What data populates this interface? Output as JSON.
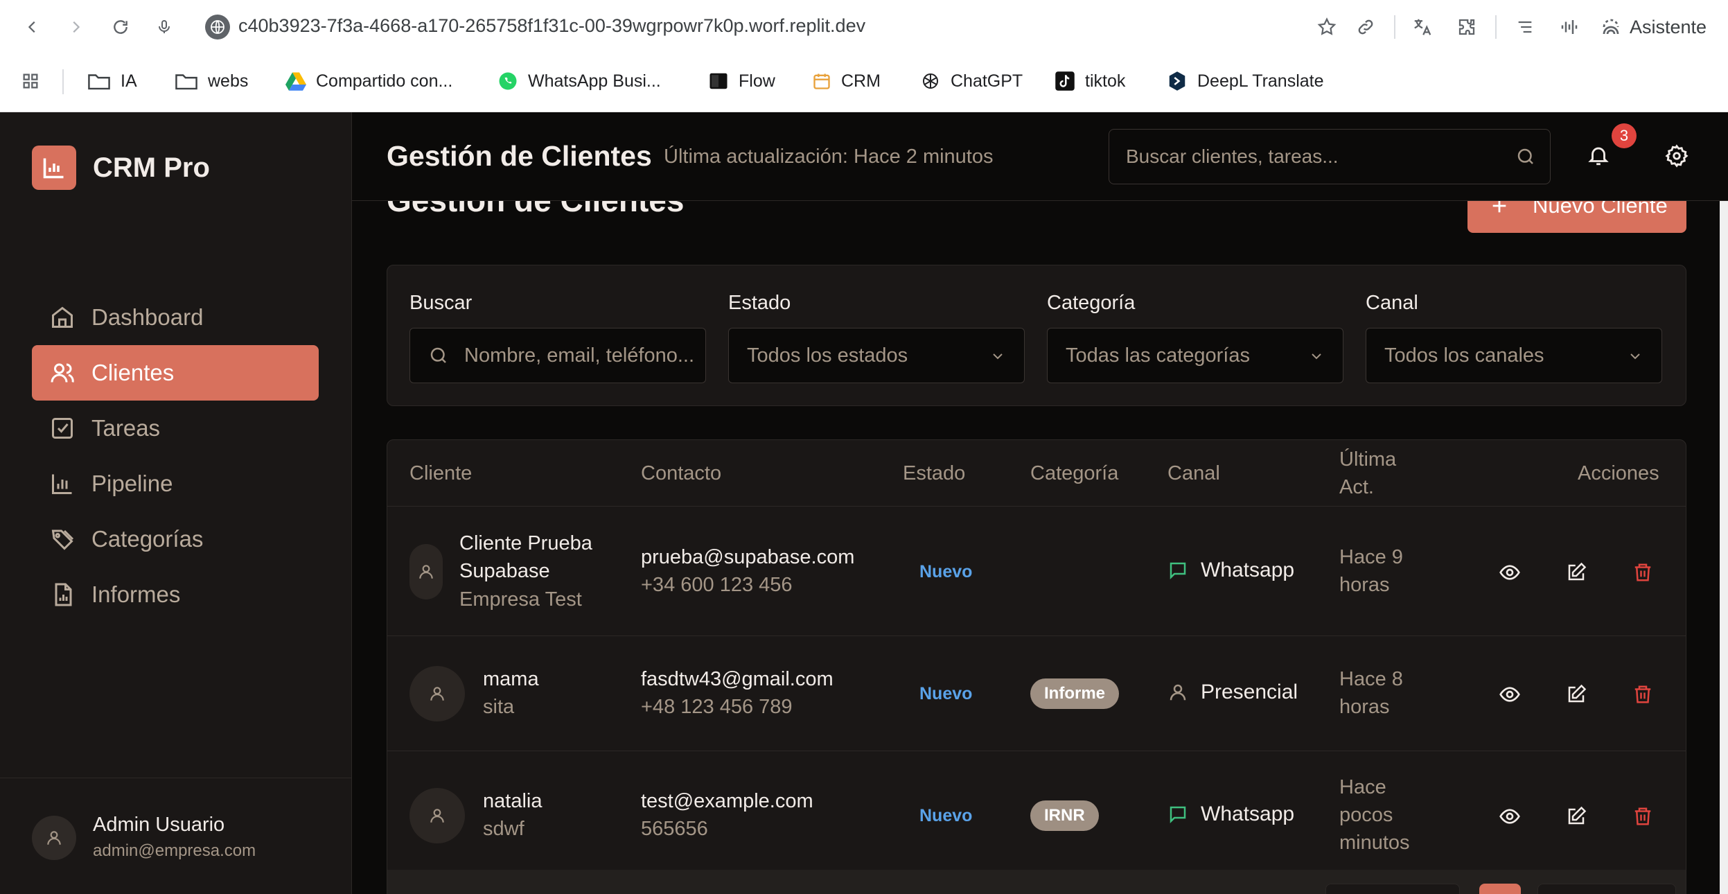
{
  "browser": {
    "url": "c40b3923-7f3a-4668-a170-265758f1f31c-00-39wgrpowr7k0p.worf.replit.dev",
    "assistant_label": "Asistente",
    "bookmarks": [
      {
        "label": "IA",
        "icon": "folder-icon"
      },
      {
        "label": "webs",
        "icon": "folder-icon"
      },
      {
        "label": "Compartido con...",
        "icon": "drive-icon"
      },
      {
        "label": "WhatsApp Busi...",
        "icon": "whatsapp-icon"
      },
      {
        "label": "Flow",
        "icon": "flow-icon"
      },
      {
        "label": "CRM",
        "icon": "crm-icon"
      },
      {
        "label": "ChatGPT",
        "icon": "chatgpt-icon"
      },
      {
        "label": "tiktok",
        "icon": "tiktok-icon"
      },
      {
        "label": "DeepL Translate",
        "icon": "deepl-icon"
      }
    ]
  },
  "app": {
    "name": "CRM Pro",
    "accent": "#d8715d",
    "sidebar": {
      "items": [
        {
          "label": "Dashboard",
          "icon": "home-icon"
        },
        {
          "label": "Clientes",
          "icon": "users-icon",
          "active": true
        },
        {
          "label": "Tareas",
          "icon": "checkbox-icon"
        },
        {
          "label": "Pipeline",
          "icon": "bar-chart-icon"
        },
        {
          "label": "Categorías",
          "icon": "tags-icon"
        },
        {
          "label": "Informes",
          "icon": "report-icon"
        }
      ],
      "user": {
        "name": "Admin Usuario",
        "email": "admin@empresa.com"
      }
    },
    "topbar": {
      "title": "Gestión de Clientes",
      "updated": "Última actualización:  Hace 2 minutos",
      "search_placeholder": "Buscar clientes, tareas...",
      "notifications": "3"
    },
    "page": {
      "title": "Gestión de Clientes",
      "new_button": "Nuevo Cliente"
    },
    "filters": {
      "search_label": "Buscar",
      "search_placeholder": "Nombre, email, teléfono...",
      "estado_label": "Estado",
      "estado_value": "Todos los estados",
      "categoria_label": "Categoría",
      "categoria_value": "Todas las categorías",
      "canal_label": "Canal",
      "canal_value": "Todos los canales"
    },
    "table": {
      "headers": {
        "cliente": "Cliente",
        "contacto": "Contacto",
        "estado": "Estado",
        "categoria": "Categoría",
        "canal": "Canal",
        "ultima_1": "Última",
        "ultima_2": "Act.",
        "acciones": "Acciones"
      },
      "rows": [
        {
          "name_1": "Cliente Prueba",
          "name_2": "Supabase",
          "company": "Empresa Test",
          "email": "prueba@supabase.com",
          "phone": "+34 600 123 456",
          "status": "Nuevo",
          "category": "",
          "channel": "Whatsapp",
          "updated_1": "Hace 9",
          "updated_2": "horas"
        },
        {
          "name_1": "mama",
          "company": "sita",
          "email": "fasdtw43@gmail.com",
          "phone": "+48 123 456 789",
          "status": "Nuevo",
          "category": "Informe",
          "channel": "Presencial",
          "updated_1": "Hace 8",
          "updated_2": "horas"
        },
        {
          "name_1": "natalia",
          "company": "sdwf",
          "email": "test@example.com",
          "phone": "565656",
          "status": "Nuevo",
          "category": "IRNR",
          "channel": "Whatsapp",
          "updated_1": "Hace",
          "updated_2": "pocos",
          "updated_3": "minutos"
        }
      ]
    }
  }
}
